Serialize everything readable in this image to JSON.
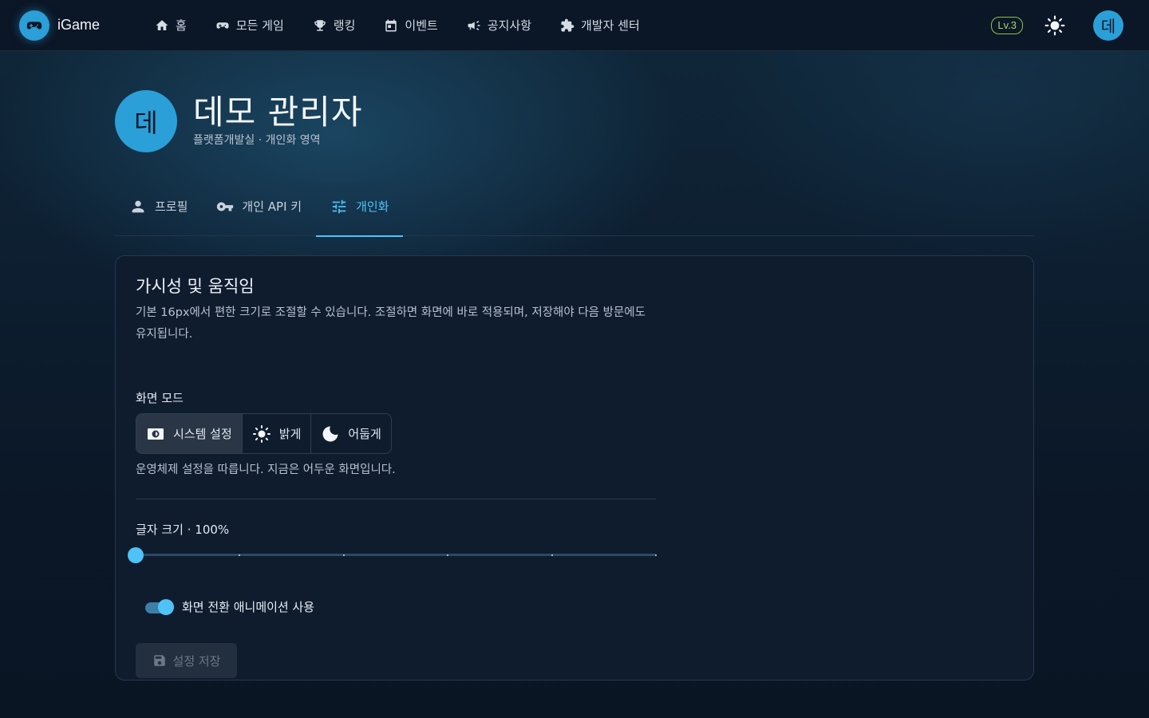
{
  "brand": {
    "name": "iGame",
    "logo_icon": "gamepad-icon"
  },
  "nav": {
    "items": [
      {
        "label": "홈",
        "icon": "home-icon"
      },
      {
        "label": "모든 게임",
        "icon": "gamepad-icon"
      },
      {
        "label": "랭킹",
        "icon": "trophy-icon"
      },
      {
        "label": "이벤트",
        "icon": "calendar-icon"
      },
      {
        "label": "공지사항",
        "icon": "megaphone-icon"
      },
      {
        "label": "개발자 센터",
        "icon": "puzzle-icon"
      }
    ],
    "level": "Lv.3",
    "theme_icon": "sun-icon",
    "avatar_initial": "데"
  },
  "profile": {
    "avatar_initial": "데",
    "title": "데모 관리자",
    "subtitle": "플랫폼개발실 · 개인화 영역"
  },
  "tabs": [
    {
      "label": "프로필",
      "icon": "person-icon",
      "active": false
    },
    {
      "label": "개인 API 키",
      "icon": "key-icon",
      "active": false
    },
    {
      "label": "개인화",
      "icon": "tune-icon",
      "active": true
    }
  ],
  "card": {
    "title": "가시성 및 움직임",
    "description": "기본 16px에서 편한 크기로 조절할 수 있습니다. 조절하면 화면에 바로 적용되며, 저장해야 다음 방문에도 유지됩니다.",
    "mode": {
      "label": "화면 모드",
      "options": [
        {
          "label": "시스템 설정",
          "icon": "brightness-auto-icon",
          "selected": true
        },
        {
          "label": "밝게",
          "icon": "sun-icon",
          "selected": false
        },
        {
          "label": "어둡게",
          "icon": "moon-icon",
          "selected": false
        }
      ],
      "help": "운영체제 설정을 따릅니다. 지금은 어두운 화면입니다."
    },
    "font_size": {
      "label": "글자 크기 · 100%",
      "value_fraction": 0,
      "steps": 5
    },
    "animation_toggle": {
      "label": "화면 전환 애니메이션 사용",
      "on": true
    },
    "save_button": {
      "label": "설정 저장",
      "icon": "save-icon",
      "disabled": true
    }
  },
  "colors": {
    "accent": "#4fc3f7",
    "avatar": "#2b9fd8",
    "level_badge": "#8bc34a",
    "background": "#0c1828"
  }
}
